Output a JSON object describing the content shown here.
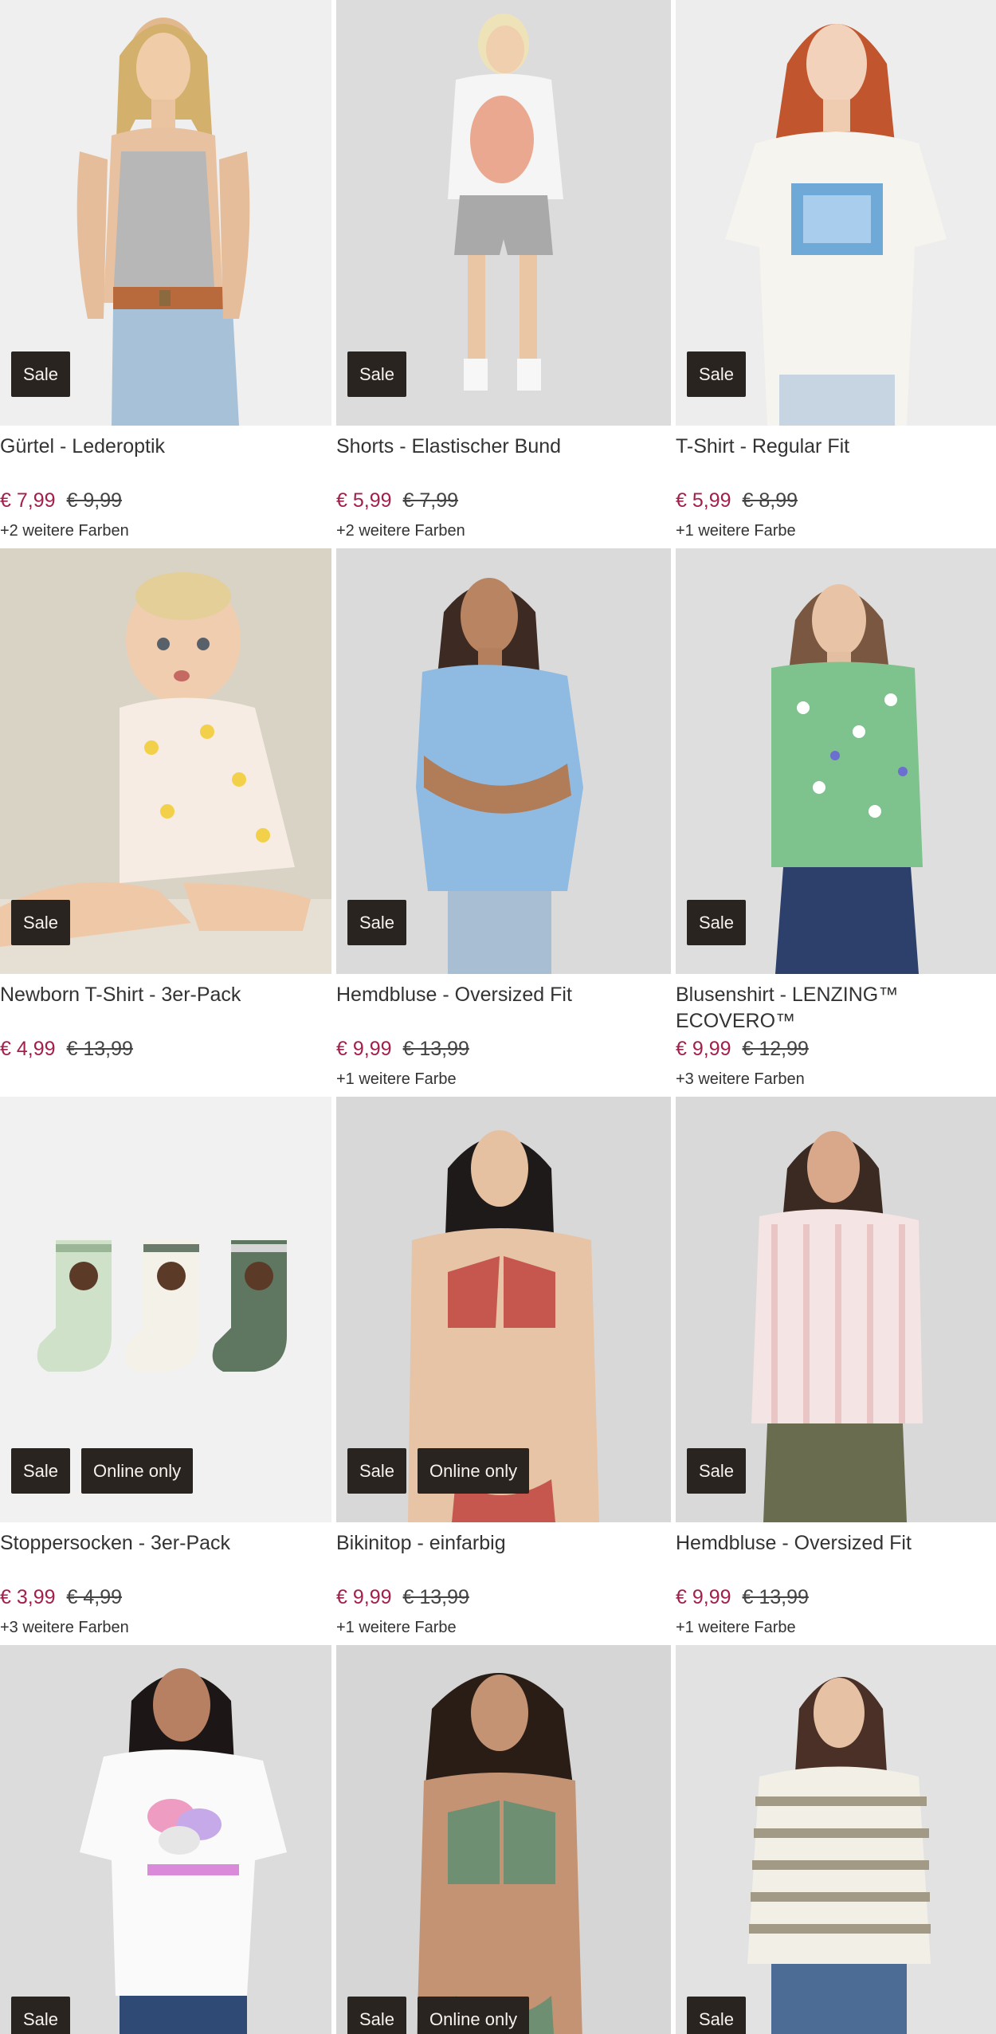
{
  "products": [
    {
      "title": "Gürtel - Lederoptik",
      "price": "€ 7,99",
      "old_price": "€ 9,99",
      "colors": "+2 weitere Farben",
      "badges": [
        "Sale"
      ],
      "bg": "#efefef",
      "motif": "woman-tank-belt"
    },
    {
      "title": "Shorts - Elastischer Bund",
      "price": "€ 5,99",
      "old_price": "€ 7,99",
      "colors": "+2 weitere Farben",
      "badges": [
        "Sale"
      ],
      "bg": "#dcdcdc",
      "motif": "woman-tee-shorts"
    },
    {
      "title": "T-Shirt - Regular Fit",
      "price": "€ 5,99",
      "old_price": "€ 8,99",
      "colors": "+1 weitere Farbe",
      "badges": [
        "Sale"
      ],
      "bg": "#ededed",
      "motif": "woman-print-tee"
    },
    {
      "title": "Newborn T-Shirt - 3er-Pack",
      "price": "€ 4,99",
      "old_price": "€ 13,99",
      "colors": "",
      "badges": [
        "Sale"
      ],
      "bg": "#d9d3c6",
      "motif": "baby-tee"
    },
    {
      "title": "Hemdbluse - Oversized Fit",
      "price": "€ 9,99",
      "old_price": "€ 13,99",
      "colors": "+1 weitere Farbe",
      "badges": [
        "Sale"
      ],
      "bg": "#dadada",
      "motif": "woman-blue-shirt"
    },
    {
      "title": "Blusenshirt - LENZING™ ECOVERO™",
      "price": "€ 9,99",
      "old_price": "€ 12,99",
      "colors": "+3 weitere Farben",
      "badges": [
        "Sale"
      ],
      "bg": "#dedede",
      "motif": "woman-floral-top"
    },
    {
      "title": "Stoppersocken - 3er-Pack",
      "price": "€ 3,99",
      "old_price": "€ 4,99",
      "colors": "+3 weitere Farben",
      "badges": [
        "Sale",
        "Online only"
      ],
      "bg": "#f1f1f1",
      "motif": "socks"
    },
    {
      "title": "Bikinitop - einfarbig",
      "price": "€ 9,99",
      "old_price": "€ 13,99",
      "colors": "+1 weitere Farbe",
      "badges": [
        "Sale",
        "Online only"
      ],
      "bg": "#d8d8d8",
      "motif": "woman-bikini-red"
    },
    {
      "title": "Hemdbluse - Oversized Fit",
      "price": "€ 9,99",
      "old_price": "€ 13,99",
      "colors": "+1 weitere Farbe",
      "badges": [
        "Sale"
      ],
      "bg": "#d9d9d9",
      "motif": "woman-striped-shirt"
    },
    {
      "title": "",
      "price": "",
      "old_price": "",
      "colors": "",
      "badges": [
        "Sale"
      ],
      "bg": "#dcdcdc",
      "motif": "woman-happiness-tee"
    },
    {
      "title": "",
      "price": "",
      "old_price": "",
      "colors": "",
      "badges": [
        "Sale",
        "Online only"
      ],
      "bg": "#d6d6d6",
      "motif": "woman-bikini-green"
    },
    {
      "title": "",
      "price": "",
      "old_price": "",
      "colors": "",
      "badges": [
        "Sale"
      ],
      "bg": "#e2e2e2",
      "motif": "woman-striped-sweater"
    }
  ]
}
